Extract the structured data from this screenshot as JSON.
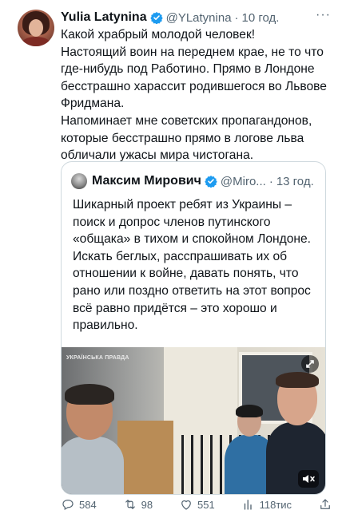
{
  "tweet": {
    "author_name": "Yulia Latynina",
    "handle": "@YLatynina",
    "separator": "·",
    "time": "10 год.",
    "more": "···",
    "text": "Какой храбрый молодой человек!\nНастоящий воин на переднем крае, не то что где-нибудь под Работино. Прямо  в Лондоне бесстрашно харассит родившегося во Львове Фридмана.\nНапоминает мне советских пропагандонов, которые бесстрашно прямо в логове льва обличали ужасы мира чистогана."
  },
  "quote": {
    "author_name": "Максим Мирович",
    "handle": "@Miro...",
    "separator": "·",
    "time": "13 год.",
    "text": "Шикарный проект ребят из Украины – поиск и допрос членов путинского «общака» в тихом и спокойном Лондоне. Искать беглых, расспрашивать их об отношении к войне, давать понять, что рано или поздно ответить на этот вопрос всё равно придётся – это хорошо и правильно.",
    "video_logo_text": "УКРАЇНСЬКА ПРАВДА"
  },
  "actions": {
    "replies": "584",
    "reposts": "98",
    "likes": "551",
    "views": "118тис"
  },
  "icons": [
    "verified-badge-icon",
    "more-icon",
    "expand-icon",
    "mute-icon",
    "reply-icon",
    "repost-icon",
    "like-icon",
    "views-icon",
    "share-icon"
  ],
  "colors": {
    "verified": "#1d9bf0",
    "text": "#0f1419",
    "secondary": "#536471",
    "border": "#cfd9de"
  }
}
